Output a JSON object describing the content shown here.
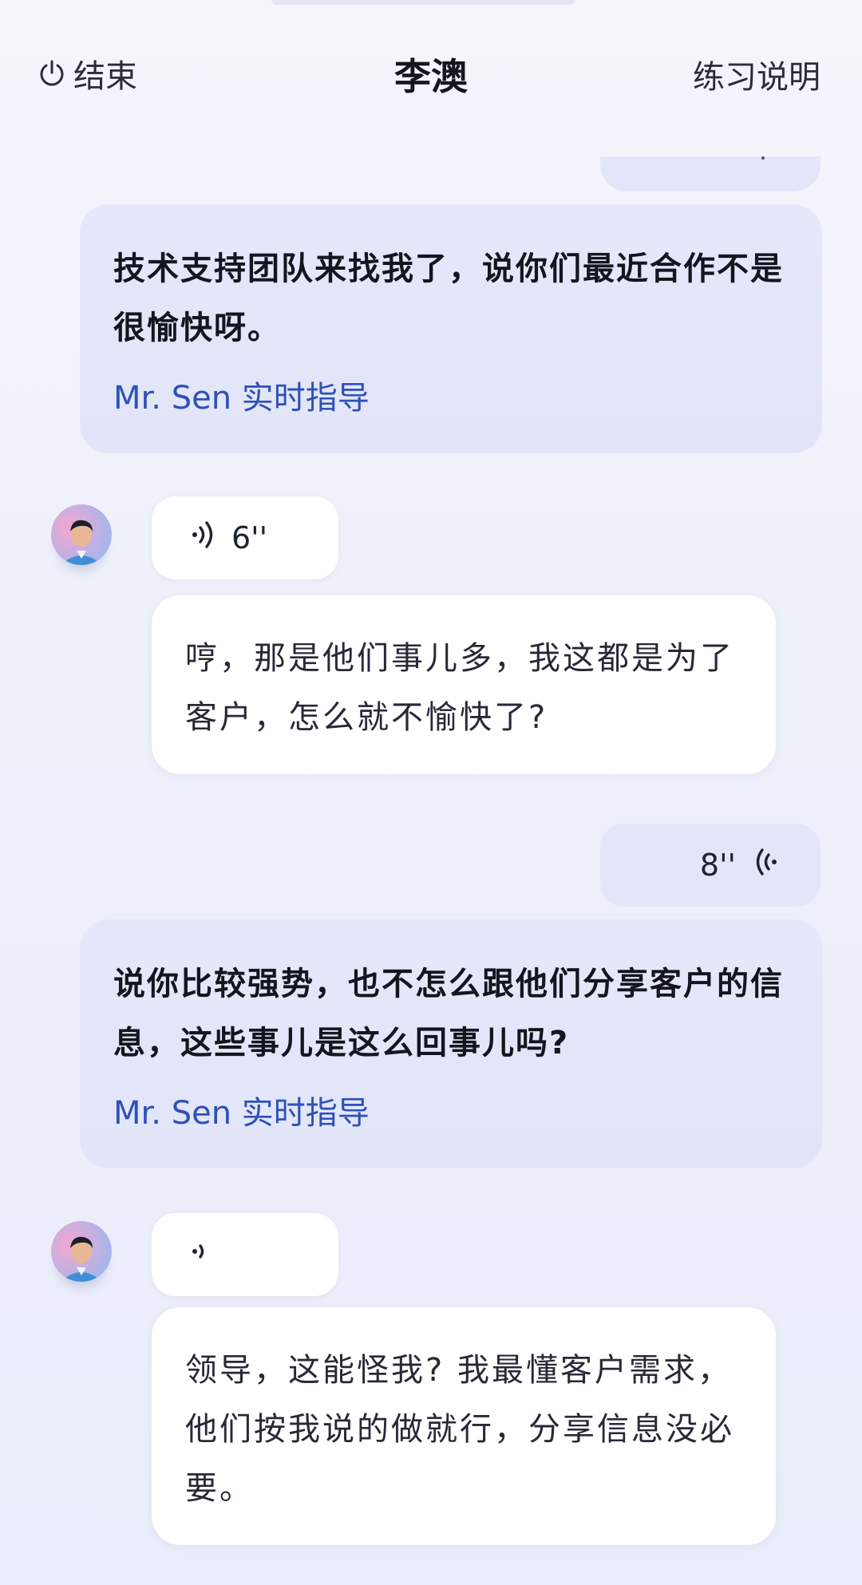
{
  "header": {
    "end_label": "结束",
    "title": "李澳",
    "help_label": "练习说明"
  },
  "messages": [
    {
      "role": "user",
      "text": "技术支持团队来找我了，说你们最近合作不是很愉快呀。",
      "guide": "Mr. Sen 实时指导"
    },
    {
      "role": "ai",
      "voice_duration": "6''",
      "text": "哼，那是他们事儿多，我这都是为了客户，怎么就不愉快了?"
    },
    {
      "role": "user_voice",
      "voice_duration": "8''"
    },
    {
      "role": "user",
      "text": "说你比较强势，也不怎么跟他们分享客户的信息，这些事儿是这么回事儿吗?",
      "guide": "Mr. Sen 实时指导"
    },
    {
      "role": "ai",
      "voice_duration": "",
      "text": "领导，这能怪我? 我最懂客户需求，他们按我说的做就行，分享信息没必要。"
    }
  ],
  "colors": {
    "accent": "#2e50b8",
    "user_bubble": "#e2e6f8",
    "ai_bubble": "#ffffff"
  }
}
